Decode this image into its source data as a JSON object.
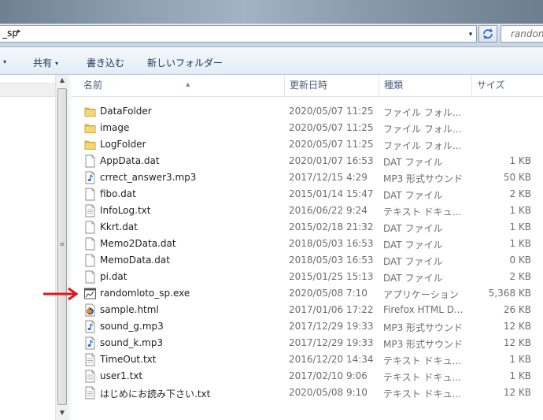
{
  "address": {
    "segment": "_sp",
    "segment_arrow": "▸",
    "dropdown": "▾",
    "search_placeholder": "randon"
  },
  "toolbar": {
    "organize_caret": "▾",
    "share_label": "共有",
    "share_caret": "▾",
    "burn_label": "書き込む",
    "new_folder_label": "新しいフォルダー"
  },
  "columns": {
    "name": "名前",
    "date": "更新日時",
    "type": "種類",
    "size": "サイズ"
  },
  "colors": {
    "folder": "#e8c454",
    "arrow": "#e0171c",
    "selection": "#f0f0f0"
  },
  "files": [
    {
      "name": "DataFolder",
      "date": "2020/05/07 11:25",
      "type": "ファイル フォル...",
      "size": "",
      "icon": "folder-icon"
    },
    {
      "name": "image",
      "date": "2020/05/07 11:25",
      "type": "ファイル フォル...",
      "size": "",
      "icon": "folder-icon"
    },
    {
      "name": "LogFolder",
      "date": "2020/05/07 11:25",
      "type": "ファイル フォル...",
      "size": "",
      "icon": "folder-icon"
    },
    {
      "name": "AppData.dat",
      "date": "2020/01/07 16:53",
      "type": "DAT ファイル",
      "size": "1 KB",
      "icon": "file-icon"
    },
    {
      "name": "crrect_answer3.mp3",
      "date": "2017/12/15 4:29",
      "type": "MP3 形式サウンド",
      "size": "50 KB",
      "icon": "audio-file-icon"
    },
    {
      "name": "fibo.dat",
      "date": "2015/01/14 15:47",
      "type": "DAT ファイル",
      "size": "2 KB",
      "icon": "file-icon"
    },
    {
      "name": "InfoLog.txt",
      "date": "2016/06/22 9:24",
      "type": "テキスト ドキュ...",
      "size": "1 KB",
      "icon": "text-file-icon"
    },
    {
      "name": "Kkrt.dat",
      "date": "2015/02/18 21:32",
      "type": "DAT ファイル",
      "size": "1 KB",
      "icon": "file-icon"
    },
    {
      "name": "Memo2Data.dat",
      "date": "2018/05/03 16:53",
      "type": "DAT ファイル",
      "size": "1 KB",
      "icon": "file-icon"
    },
    {
      "name": "MemoData.dat",
      "date": "2018/05/03 16:53",
      "type": "DAT ファイル",
      "size": "0 KB",
      "icon": "file-icon"
    },
    {
      "name": "pi.dat",
      "date": "2015/01/25 15:13",
      "type": "DAT ファイル",
      "size": "2 KB",
      "icon": "file-icon"
    },
    {
      "name": "randomloto_sp.exe",
      "date": "2020/05/08 7:10",
      "type": "アプリケーション",
      "size": "5,368 KB",
      "icon": "application-icon"
    },
    {
      "name": "sample.html",
      "date": "2017/01/06 17:22",
      "type": "Firefox HTML D...",
      "size": "26 KB",
      "icon": "firefox-html-icon"
    },
    {
      "name": "sound_g.mp3",
      "date": "2017/12/29 19:33",
      "type": "MP3 形式サウンド",
      "size": "12 KB",
      "icon": "audio-file-icon"
    },
    {
      "name": "sound_k.mp3",
      "date": "2017/12/29 19:33",
      "type": "MP3 形式サウンド",
      "size": "12 KB",
      "icon": "audio-file-icon"
    },
    {
      "name": "TimeOut.txt",
      "date": "2016/12/20 14:34",
      "type": "テキスト ドキュ...",
      "size": "1 KB",
      "icon": "text-file-icon"
    },
    {
      "name": "user1.txt",
      "date": "2017/02/10 9:06",
      "type": "テキスト ドキュ...",
      "size": "1 KB",
      "icon": "text-file-icon"
    },
    {
      "name": "はじめにお読み下さい.txt",
      "date": "2020/05/08 9:10",
      "type": "テキスト ドキュ...",
      "size": "12 KB",
      "icon": "text-file-icon"
    }
  ]
}
